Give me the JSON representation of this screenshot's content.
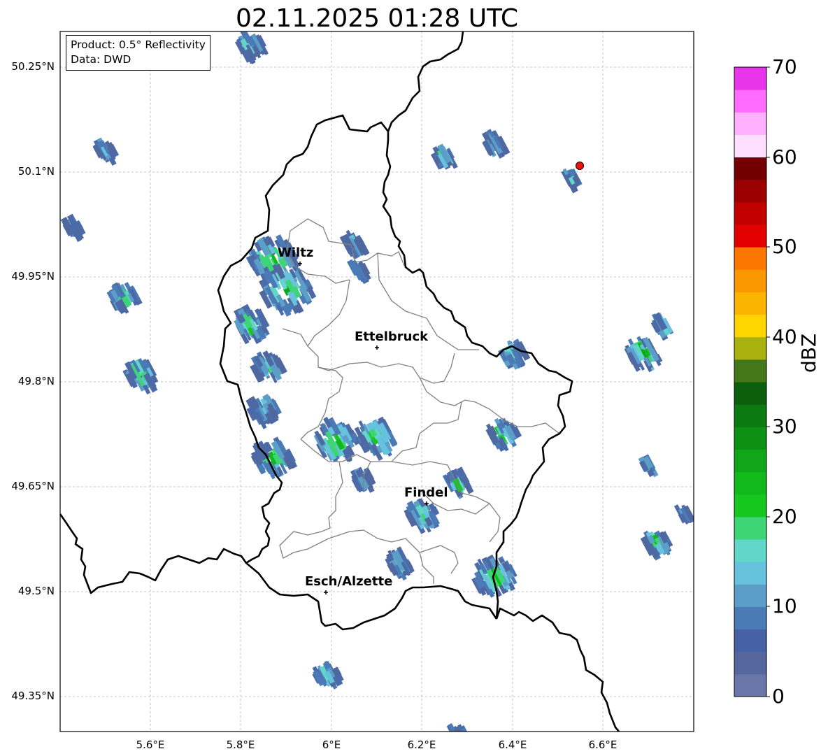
{
  "title": "02.11.2025 01:28 UTC",
  "info": {
    "product": "Product: 0.5° Reflectivity",
    "source": "Data: DWD"
  },
  "axes": {
    "lat_ticks": [
      "50.25°N",
      "50.1°N",
      "49.95°N",
      "49.8°N",
      "49.65°N",
      "49.5°N",
      "49.35°N"
    ],
    "lon_ticks": [
      "5.6°E",
      "5.8°E",
      "6°E",
      "6.2°E",
      "6.4°E",
      "6.6°E"
    ]
  },
  "cities": [
    {
      "name": "Wiltz",
      "lat": 49.967,
      "lon": 5.932
    },
    {
      "name": "Ettelbruck",
      "lat": 49.848,
      "lon": 6.104
    },
    {
      "name": "Findel",
      "lat": 49.627,
      "lon": 6.211
    },
    {
      "name": "Esch/Alzette",
      "lat": 49.497,
      "lon": 5.99
    }
  ],
  "radar_site": {
    "lat": 50.11,
    "lon": 6.548,
    "color": "#ee1111"
  },
  "colorbar": {
    "label": "dBZ",
    "ticks": [
      "0",
      "10",
      "20",
      "30",
      "40",
      "50",
      "60",
      "70"
    ],
    "min": 0,
    "max": 70,
    "step": 2.5,
    "colors": [
      "#6a75a8",
      "#56679f",
      "#4661a5",
      "#4a7bb6",
      "#5b9ec8",
      "#67c2de",
      "#62d6c8",
      "#3ed576",
      "#16c81e",
      "#12b91a",
      "#0fa719",
      "#0c9114",
      "#0a7a11",
      "#0c5e0c",
      "#447717",
      "#a9b10f",
      "#fed500",
      "#fbb500",
      "#fb9800",
      "#fb7700",
      "#e30000",
      "#c20000",
      "#9d0000",
      "#730000",
      "#ffdfff",
      "#ffb0ff",
      "#ff6cff",
      "#e935e9"
    ]
  },
  "echo_colors": [
    "#4c6aa7",
    "#5068a0",
    "#4a7bb6",
    "#5b9ec8",
    "#67c2de",
    "#62d6c8",
    "#3ed576",
    "#16c81e",
    "#12b91a",
    "#0fa719"
  ],
  "echo_cells": [
    {
      "lat": 49.975,
      "lon": 5.87,
      "r": 0.05,
      "max": 24
    },
    {
      "lat": 49.93,
      "lon": 5.9,
      "r": 0.055,
      "max": 22
    },
    {
      "lat": 49.88,
      "lon": 5.82,
      "r": 0.035,
      "max": 20
    },
    {
      "lat": 49.82,
      "lon": 5.86,
      "r": 0.03,
      "max": 14
    },
    {
      "lat": 49.76,
      "lon": 5.85,
      "r": 0.03,
      "max": 12
    },
    {
      "lat": 49.69,
      "lon": 5.87,
      "r": 0.04,
      "max": 24
    },
    {
      "lat": 49.715,
      "lon": 6.01,
      "r": 0.045,
      "max": 24
    },
    {
      "lat": 49.72,
      "lon": 6.1,
      "r": 0.04,
      "max": 20
    },
    {
      "lat": 49.61,
      "lon": 6.2,
      "r": 0.03,
      "max": 20
    },
    {
      "lat": 49.655,
      "lon": 6.28,
      "r": 0.025,
      "max": 18
    },
    {
      "lat": 49.52,
      "lon": 6.36,
      "r": 0.045,
      "max": 20
    },
    {
      "lat": 49.54,
      "lon": 6.15,
      "r": 0.025,
      "max": 12
    },
    {
      "lat": 49.725,
      "lon": 6.38,
      "r": 0.03,
      "max": 22
    },
    {
      "lat": 49.84,
      "lon": 6.4,
      "r": 0.025,
      "max": 18
    },
    {
      "lat": 49.84,
      "lon": 6.69,
      "r": 0.035,
      "max": 22
    },
    {
      "lat": 49.88,
      "lon": 6.73,
      "r": 0.015,
      "max": 20
    },
    {
      "lat": 49.81,
      "lon": 5.58,
      "r": 0.03,
      "max": 22
    },
    {
      "lat": 49.92,
      "lon": 5.54,
      "r": 0.03,
      "max": 18
    },
    {
      "lat": 50.13,
      "lon": 5.5,
      "r": 0.02,
      "max": 12
    },
    {
      "lat": 50.02,
      "lon": 5.43,
      "r": 0.015,
      "max": 14
    },
    {
      "lat": 50.28,
      "lon": 5.82,
      "r": 0.03,
      "max": 12
    },
    {
      "lat": 50.14,
      "lon": 6.36,
      "r": 0.02,
      "max": 14
    },
    {
      "lat": 50.12,
      "lon": 6.25,
      "r": 0.02,
      "max": 16
    },
    {
      "lat": 50.09,
      "lon": 6.53,
      "r": 0.012,
      "max": 18
    },
    {
      "lat": 49.57,
      "lon": 6.72,
      "r": 0.025,
      "max": 20
    },
    {
      "lat": 49.68,
      "lon": 6.7,
      "r": 0.012,
      "max": 22
    },
    {
      "lat": 49.38,
      "lon": 5.99,
      "r": 0.025,
      "max": 12
    },
    {
      "lat": 49.29,
      "lon": 6.28,
      "r": 0.025,
      "max": 10
    },
    {
      "lat": 49.995,
      "lon": 6.05,
      "r": 0.02,
      "max": 12
    },
    {
      "lat": 49.96,
      "lon": 6.06,
      "r": 0.015,
      "max": 10
    },
    {
      "lat": 49.66,
      "lon": 6.07,
      "r": 0.02,
      "max": 10
    },
    {
      "lat": 49.61,
      "lon": 6.78,
      "r": 0.012,
      "max": 10
    }
  ]
}
